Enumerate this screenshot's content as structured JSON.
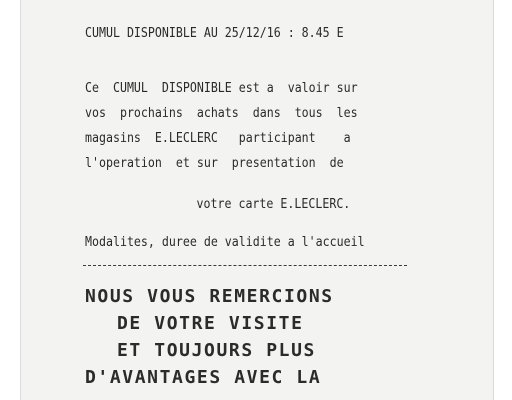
{
  "receipt": {
    "balance_line": "CUMUL DISPONIBLE AU 25/12/16 : 8.45 E",
    "paragraph": [
      "Ce  CUMUL  DISPONIBLE est a  valoir sur",
      "vos  prochains  achats  dans  tous  les",
      "magasins  E.LECLERC   participant    a",
      "l'operation  et sur  presentation  de",
      "votre carte E.LECLERC."
    ],
    "conditions": "Modalites, duree de validite a l'accueil",
    "thanks": [
      "NOUS VOUS REMERCIONS",
      "DE VOTRE VISITE",
      "ET TOUJOURS PLUS",
      "D'AVANTAGES AVEC LA"
    ]
  }
}
